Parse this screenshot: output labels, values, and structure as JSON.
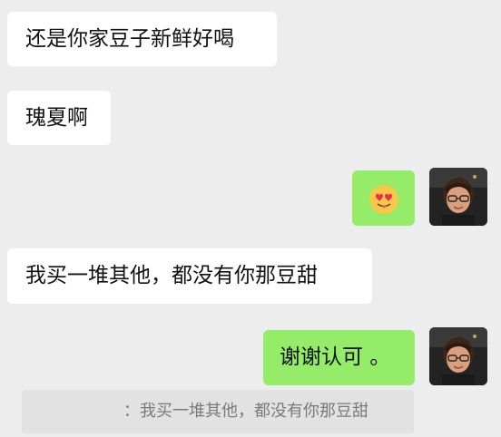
{
  "chat": {
    "messages": [
      {
        "side": "left",
        "text": "还是你家豆子新鲜好喝"
      },
      {
        "side": "left",
        "text": "瑰夏啊"
      },
      {
        "side": "right",
        "emoji": "heart-eyes-tongue-emoji"
      },
      {
        "side": "left",
        "text": "我买一堆其他，都没有你那豆甜"
      },
      {
        "side": "right",
        "text": "谢谢认可 。"
      }
    ],
    "quote": {
      "text": "：我买一堆其他，都没有你那豆甜"
    }
  },
  "colors": {
    "background": "#ededed",
    "bubble_left": "#ffffff",
    "bubble_right": "#95ec69",
    "quote_bg": "#e2e2e2"
  }
}
